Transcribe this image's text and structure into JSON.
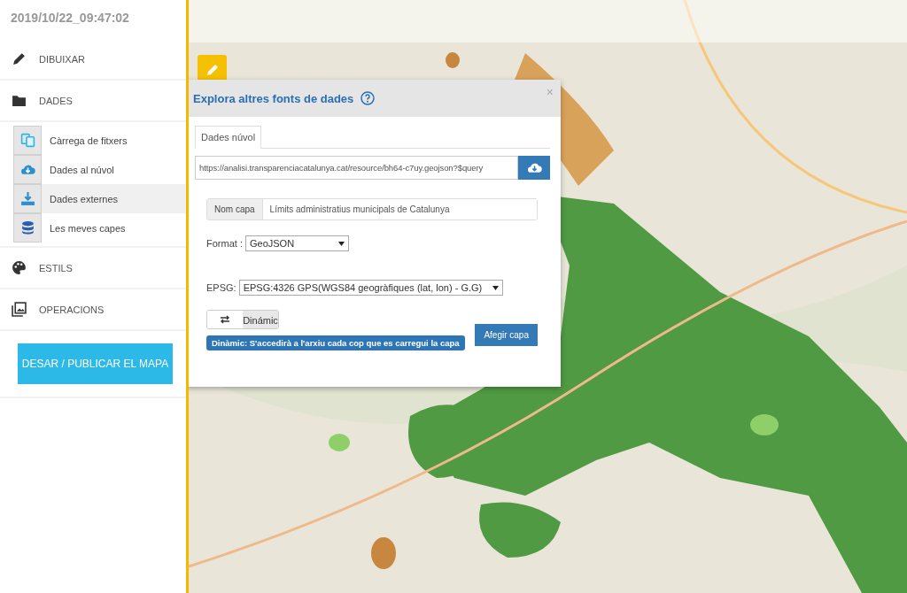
{
  "timestamp": "2019/10/22_09:47:02",
  "menu": [
    {
      "label": "DIBUIXAR",
      "kind": "pencil"
    },
    {
      "label": "DADES",
      "kind": "folder",
      "children": [
        {
          "label": "Càrrega de fitxers",
          "kind": "files",
          "selected": false
        },
        {
          "label": "Dades al núvol",
          "kind": "cloud",
          "selected": false
        },
        {
          "label": "Dades externes",
          "kind": "download",
          "selected": true
        },
        {
          "label": "Les meves capes",
          "kind": "database",
          "selected": false
        }
      ]
    },
    {
      "label": "ESTILS",
      "kind": "palette"
    },
    {
      "label": "OPERACIONS",
      "kind": "images"
    }
  ],
  "publish_button": "DESAR / PUBLICAR EL MAPA",
  "dialog": {
    "title": "Explora altres fonts de dades",
    "close": "×",
    "tabs": [
      {
        "label": "Dades núvol",
        "selected": true
      }
    ],
    "url": "https://analisi.transparenciacatalunya.cat/resource/bh64-c7uy.geojson?$query",
    "layer_name": {
      "label": "Nom capa",
      "value": "Límits administratius municipals de Catalunya"
    },
    "format": {
      "label": "Format :",
      "value": "GeoJSON"
    },
    "epsg": {
      "label": "EPSG:",
      "value": "EPSG:4326 GPS(WGS84 geogràfiques (lat, lon) - G.G)"
    },
    "mode_toggle": {
      "label": "Dinámic"
    },
    "mode_info": "Dinàmic: S'accedirà a l'arxiu cada cop que es carregui la capa",
    "add_button": "Afegir capa"
  }
}
